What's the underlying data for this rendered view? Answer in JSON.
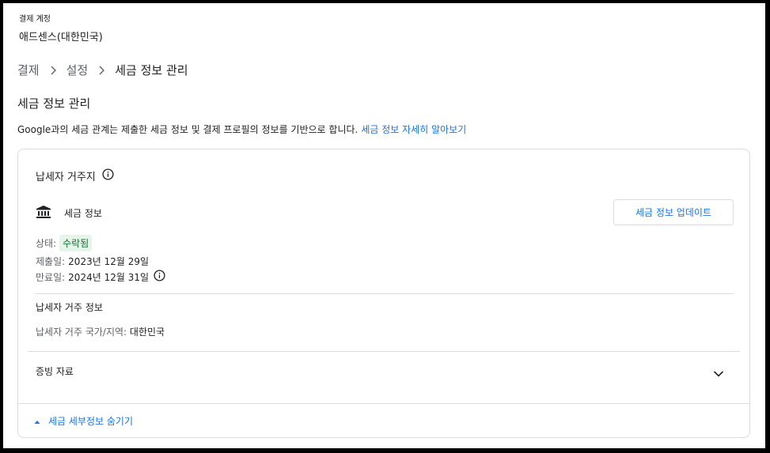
{
  "account": {
    "label": "결제 계정",
    "name": "애드센스(대한민국)"
  },
  "breadcrumb": {
    "items": [
      "결제",
      "설정",
      "세금 정보 관리"
    ]
  },
  "page": {
    "title": "세금 정보 관리",
    "description": "Google과의 세금 관계는 제출한 세금 정보 및 결제 프로필의 정보를 기반으로 합니다.",
    "learn_more": "세금 정보 자세히 알아보기"
  },
  "card": {
    "section_title": "납세자 거주지",
    "tax_info_label": "세금 정보",
    "update_button": "세금 정보 업데이트",
    "status_label": "상태:",
    "status_value": "수락됨",
    "submitted_label": "제출일:",
    "submitted_value": "2023년 12월 29일",
    "expiry_label": "만료일:",
    "expiry_value": "2024년 12월 31일",
    "residence_title": "납세자 거주 정보",
    "residence_label": "납세자 거주 국가/지역:",
    "residence_value": "대한민국",
    "evidence_label": "증빙 자료",
    "hide_details": "세금 세부정보 숨기기"
  },
  "colors": {
    "accent": "#1a73e8",
    "status_bg": "#e6f4ea",
    "status_text": "#137333",
    "border": "#dadce0"
  },
  "icons": [
    "info-icon",
    "bank-icon",
    "chevron-right-icon",
    "chevron-down-icon",
    "caret-up-icon"
  ]
}
